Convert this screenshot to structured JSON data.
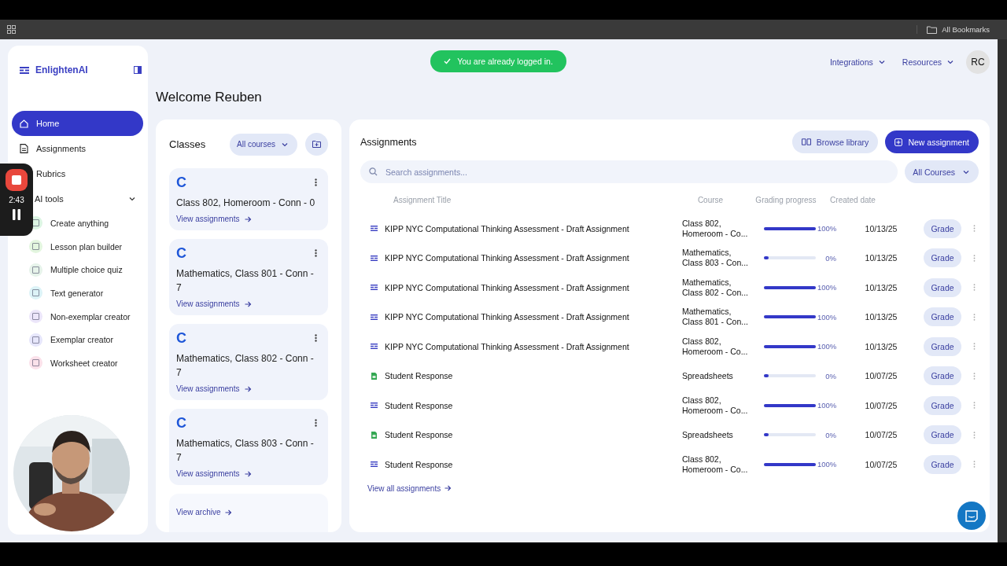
{
  "browser": {
    "bookmarks": "All Bookmarks"
  },
  "toast": {
    "text": "You are already logged in."
  },
  "nav": [
    {
      "label": "Integrations"
    },
    {
      "label": "Resources"
    }
  ],
  "avatar": "RC",
  "sidebar": {
    "brand": "EnlightenAI",
    "items": [
      {
        "label": "Home",
        "kind": "link",
        "selected": true
      },
      {
        "label": "Assignments",
        "kind": "link",
        "selected": false
      },
      {
        "label": "Rubrics",
        "kind": "link",
        "selected": false
      },
      {
        "label": "AI tools",
        "kind": "group",
        "expanded": true,
        "children": [
          {
            "label": "Create anything",
            "color": "#dcf5e3"
          },
          {
            "label": "Lesson plan builder",
            "color": "#e3f6df"
          },
          {
            "label": "Multiple choice quiz",
            "color": "#e6f3ea"
          },
          {
            "label": "Text generator",
            "color": "#dcf3f7"
          },
          {
            "label": "Non-exemplar creator",
            "color": "#ece6fa"
          },
          {
            "label": "Exemplar creator",
            "color": "#e6e6fb"
          },
          {
            "label": "Worksheet creator",
            "color": "#fbe1ea"
          }
        ]
      }
    ]
  },
  "welcome": "Welcome Reuben",
  "classes": {
    "title": "Classes",
    "filter": "All courses",
    "cards": [
      {
        "initial": "C",
        "name": "Class 802, Homeroom - Conn - 0",
        "link": "View assignments"
      },
      {
        "initial": "C",
        "name": "Mathematics, Class 801 - Conn - 7",
        "link": "View assignments"
      },
      {
        "initial": "C",
        "name": "Mathematics, Class 802 - Conn - 7",
        "link": "View assignments"
      },
      {
        "initial": "C",
        "name": "Mathematics, Class 803 - Conn - 7",
        "link": "View assignments"
      }
    ],
    "archive_link": "View archive"
  },
  "assignments": {
    "title": "Assignments",
    "buttons": [
      {
        "label": "Browse library",
        "kind": "secondary"
      },
      {
        "label": "New assignment",
        "kind": "primary"
      }
    ],
    "search": {
      "placeholder": "Search assignments..."
    },
    "filter": "All Courses",
    "columns": [
      "Assignment Title",
      "Course",
      "Grading progress",
      "Created date"
    ],
    "rows": [
      {
        "kind": "doc",
        "title": "KIPP NYC Computational Thinking Assessment - Draft Assignment",
        "course": [
          "Class 802,",
          "Homeroom - Co..."
        ],
        "level": 1,
        "progress": "100%",
        "date": "10/13/25",
        "action": "Grade"
      },
      {
        "kind": "doc",
        "title": "KIPP NYC Computational Thinking Assessment - Draft Assignment",
        "course": [
          "Mathematics,",
          "Class 803 - Con..."
        ],
        "level": 0,
        "progress": "0%",
        "date": "10/13/25",
        "action": "Grade"
      },
      {
        "kind": "doc",
        "title": "KIPP NYC Computational Thinking Assessment - Draft Assignment",
        "course": [
          "Mathematics,",
          "Class 802 - Con..."
        ],
        "level": 1,
        "progress": "100%",
        "date": "10/13/25",
        "action": "Grade"
      },
      {
        "kind": "doc",
        "title": "KIPP NYC Computational Thinking Assessment - Draft Assignment",
        "course": [
          "Mathematics,",
          "Class 801 - Con..."
        ],
        "level": 1,
        "progress": "100%",
        "date": "10/13/25",
        "action": "Grade"
      },
      {
        "kind": "doc",
        "title": "KIPP NYC Computational Thinking Assessment - Draft Assignment",
        "course": [
          "Class 802,",
          "Homeroom - Co..."
        ],
        "level": 1,
        "progress": "100%",
        "date": "10/13/25",
        "action": "Grade"
      },
      {
        "kind": "sheet",
        "title": "Student Response",
        "course": [
          "Spreadsheets"
        ],
        "level": 0,
        "progress": "0%",
        "date": "10/07/25",
        "action": "Grade"
      },
      {
        "kind": "doc",
        "title": "Student Response",
        "course": [
          "Class 802,",
          "Homeroom - Co..."
        ],
        "level": 1,
        "progress": "100%",
        "date": "10/07/25",
        "action": "Grade"
      },
      {
        "kind": "sheet",
        "title": "Student Response",
        "course": [
          "Spreadsheets"
        ],
        "level": 0,
        "progress": "0%",
        "date": "10/07/25",
        "action": "Grade"
      },
      {
        "kind": "doc",
        "title": "Student Response",
        "course": [
          "Class 802,",
          "Homeroom - Co..."
        ],
        "level": 1,
        "progress": "100%",
        "date": "10/07/25",
        "action": "Grade"
      }
    ],
    "footer_link": "View all assignments"
  },
  "recorder": {
    "time": "2:43"
  }
}
